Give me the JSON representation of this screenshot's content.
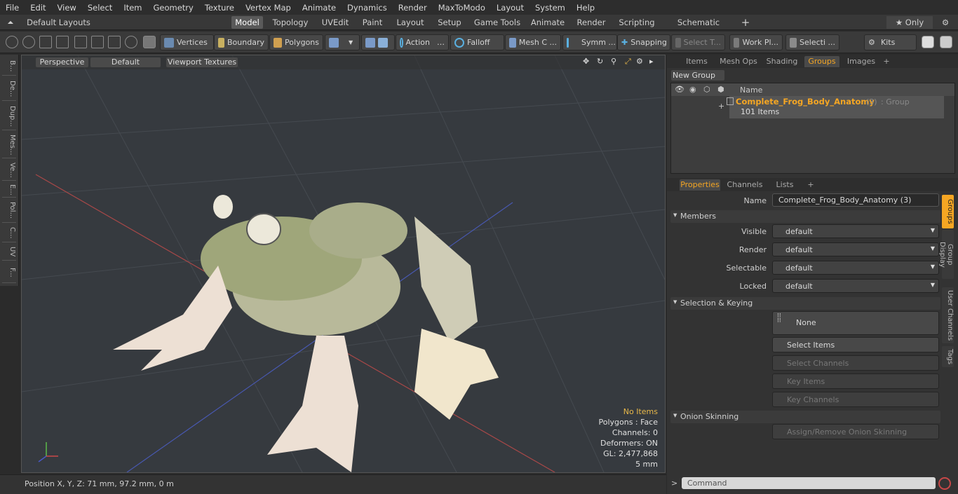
{
  "menu": [
    "File",
    "Edit",
    "View",
    "Select",
    "Item",
    "Geometry",
    "Texture",
    "Vertex Map",
    "Animate",
    "Dynamics",
    "Render",
    "MaxToModo",
    "Layout",
    "System",
    "Help"
  ],
  "layout": {
    "preset": "Default Layouts ▾",
    "tabs": [
      "Model",
      "Topology",
      "UVEdit",
      "Paint",
      "Layout",
      "Setup",
      "Game Tools",
      "Animate",
      "Render",
      "Scripting",
      "Schematic Fusion"
    ],
    "add": "+",
    "only": "★ Only",
    "gear": "⚙"
  },
  "toolbar": {
    "vertices": "Vertices",
    "boundary": "Boundary",
    "polygons": "Polygons",
    "action": "Action",
    "falloff": "Falloff",
    "mesh": "Mesh C ...",
    "symm": "Symm ...",
    "snapping": "Snapping",
    "select": "Select T...",
    "workplane": "Work Pl...",
    "selecti": "Selecti ...",
    "kits": "Kits"
  },
  "lefttabs": [
    "B...",
    "De...",
    "Dup...",
    "Mes...",
    "Ve...",
    "E...",
    "Pol...",
    "C...",
    "UV",
    "F..."
  ],
  "viewport": {
    "perspective": "Perspective",
    "default": "Default",
    "textures": "Viewport Textures",
    "stats": {
      "items": "No Items",
      "polygons": "Polygons : Face",
      "channels": "Channels: 0",
      "deformers": "Deformers: ON",
      "gl": "GL: 2,477,868",
      "scale": "5 mm"
    }
  },
  "status": {
    "position": "Position X, Y, Z:   71 mm, 97.2 mm, 0 m"
  },
  "topTabs": [
    "Items",
    "Mesh Ops",
    "Shading",
    "Groups",
    "Images",
    "+"
  ],
  "groups": {
    "newGroup": "New Group",
    "nameHeader": "Name",
    "groupName": "Complete_Frog_Body_Anatomy",
    "count": "(3)",
    "type": ": Group",
    "items": "101 Items"
  },
  "propTabs": [
    "Properties",
    "Channels",
    "Lists",
    "+"
  ],
  "props": {
    "nameLabel": "Name",
    "nameValue": "Complete_Frog_Body_Anatomy (3)",
    "members": "Members",
    "visible": "Visible",
    "render": "Render",
    "selectable": "Selectable",
    "locked": "Locked",
    "def": "default",
    "selKey": "Selection & Keying",
    "none": "None",
    "selItems": "Select Items",
    "selChannels": "Select Channels",
    "keyItems": "Key Items",
    "keyChannels": "Key Channels",
    "onion": "Onion Skinning",
    "assign": "Assign/Remove Onion Skinning"
  },
  "sideTabs": [
    "Groups",
    "Group Display",
    "User Channels",
    "Tags"
  ],
  "command": "Command"
}
